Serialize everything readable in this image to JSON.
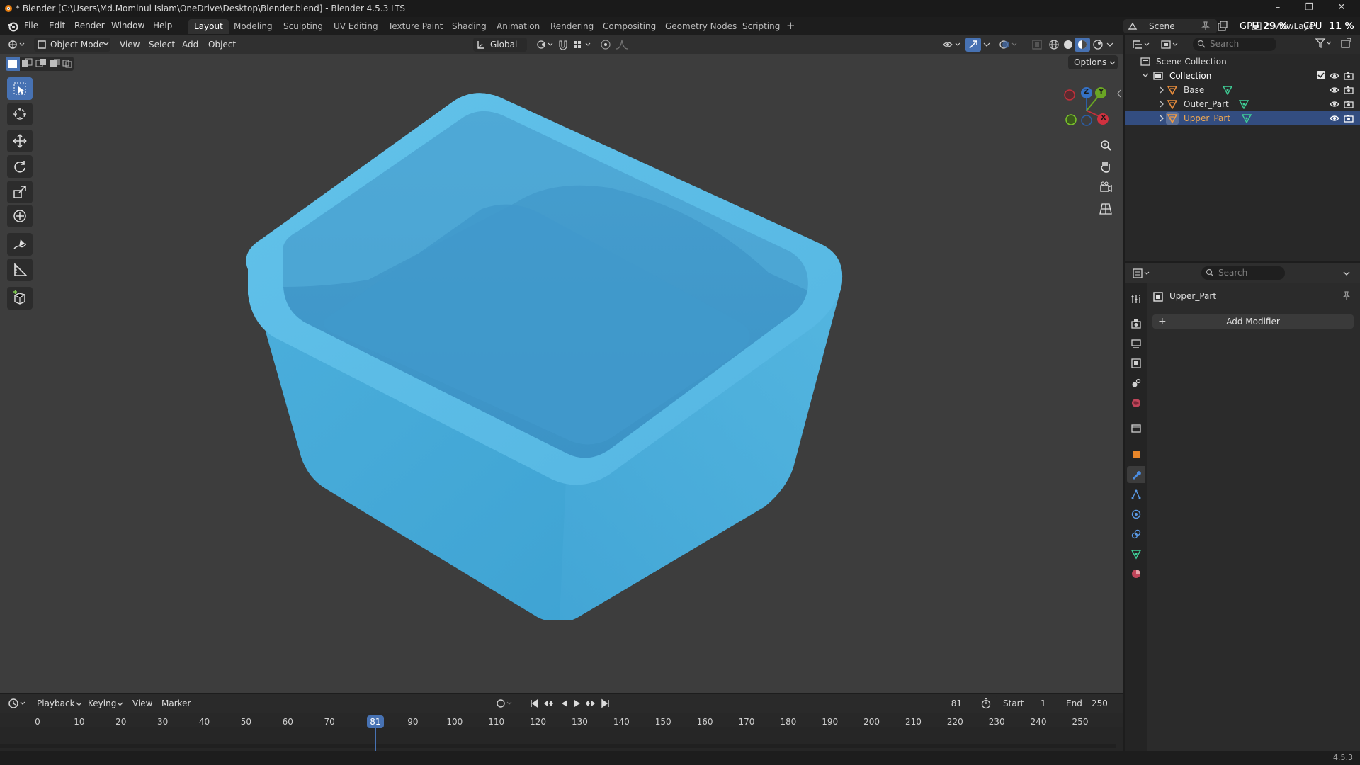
{
  "window": {
    "title": "* Blender [C:\\Users\\Md.Mominul Islam\\OneDrive\\Desktop\\Blender.blend] - Blender 4.5.3 LTS"
  },
  "menu": [
    "File",
    "Edit",
    "Render",
    "Window",
    "Help"
  ],
  "workspaces": [
    "Layout",
    "Modeling",
    "Sculpting",
    "UV Editing",
    "Texture Paint",
    "Shading",
    "Animation",
    "Rendering",
    "Compositing",
    "Geometry Nodes",
    "Scripting"
  ],
  "active_workspace": "Layout",
  "scene": {
    "name": "Scene",
    "view_layer": "ViewLayer"
  },
  "perf": {
    "gpu_label": "GPU",
    "gpu_value": "29 %",
    "cpu_label": "CPU",
    "cpu_value": "11 %"
  },
  "viewport_header": {
    "mode": "Object Mode",
    "menus": [
      "View",
      "Select",
      "Add",
      "Object"
    ],
    "transform_orientation": "Global",
    "options": "Options"
  },
  "gizmo": {
    "z": "Z",
    "y": "Y",
    "x": "X"
  },
  "timeline": {
    "menus": [
      "Playback",
      "Keying",
      "View",
      "Marker"
    ],
    "current_frame": "81",
    "start_label": "Start",
    "start": "1",
    "end_label": "End",
    "end": "250",
    "ticks": [
      "0",
      "10",
      "20",
      "30",
      "40",
      "50",
      "60",
      "70",
      "80",
      "90",
      "100",
      "110",
      "120",
      "130",
      "140",
      "150",
      "160",
      "170",
      "180",
      "190",
      "200",
      "210",
      "220",
      "230",
      "240",
      "250"
    ]
  },
  "outliner": {
    "search_placeholder": "Search",
    "scene_collection": "Scene Collection",
    "collection": "Collection",
    "objects": [
      "Base",
      "Outer_Part",
      "Upper_Part"
    ],
    "selected": "Upper_Part"
  },
  "properties": {
    "search_placeholder": "Search",
    "object_name": "Upper_Part",
    "add_modifier": "Add Modifier"
  },
  "status": {
    "version": "4.5.3"
  },
  "colors": {
    "accent": "#4772b3",
    "mesh": "#4fb0dd",
    "viewport_bg": "#3d3d3d",
    "selected_row": "#334d80"
  }
}
